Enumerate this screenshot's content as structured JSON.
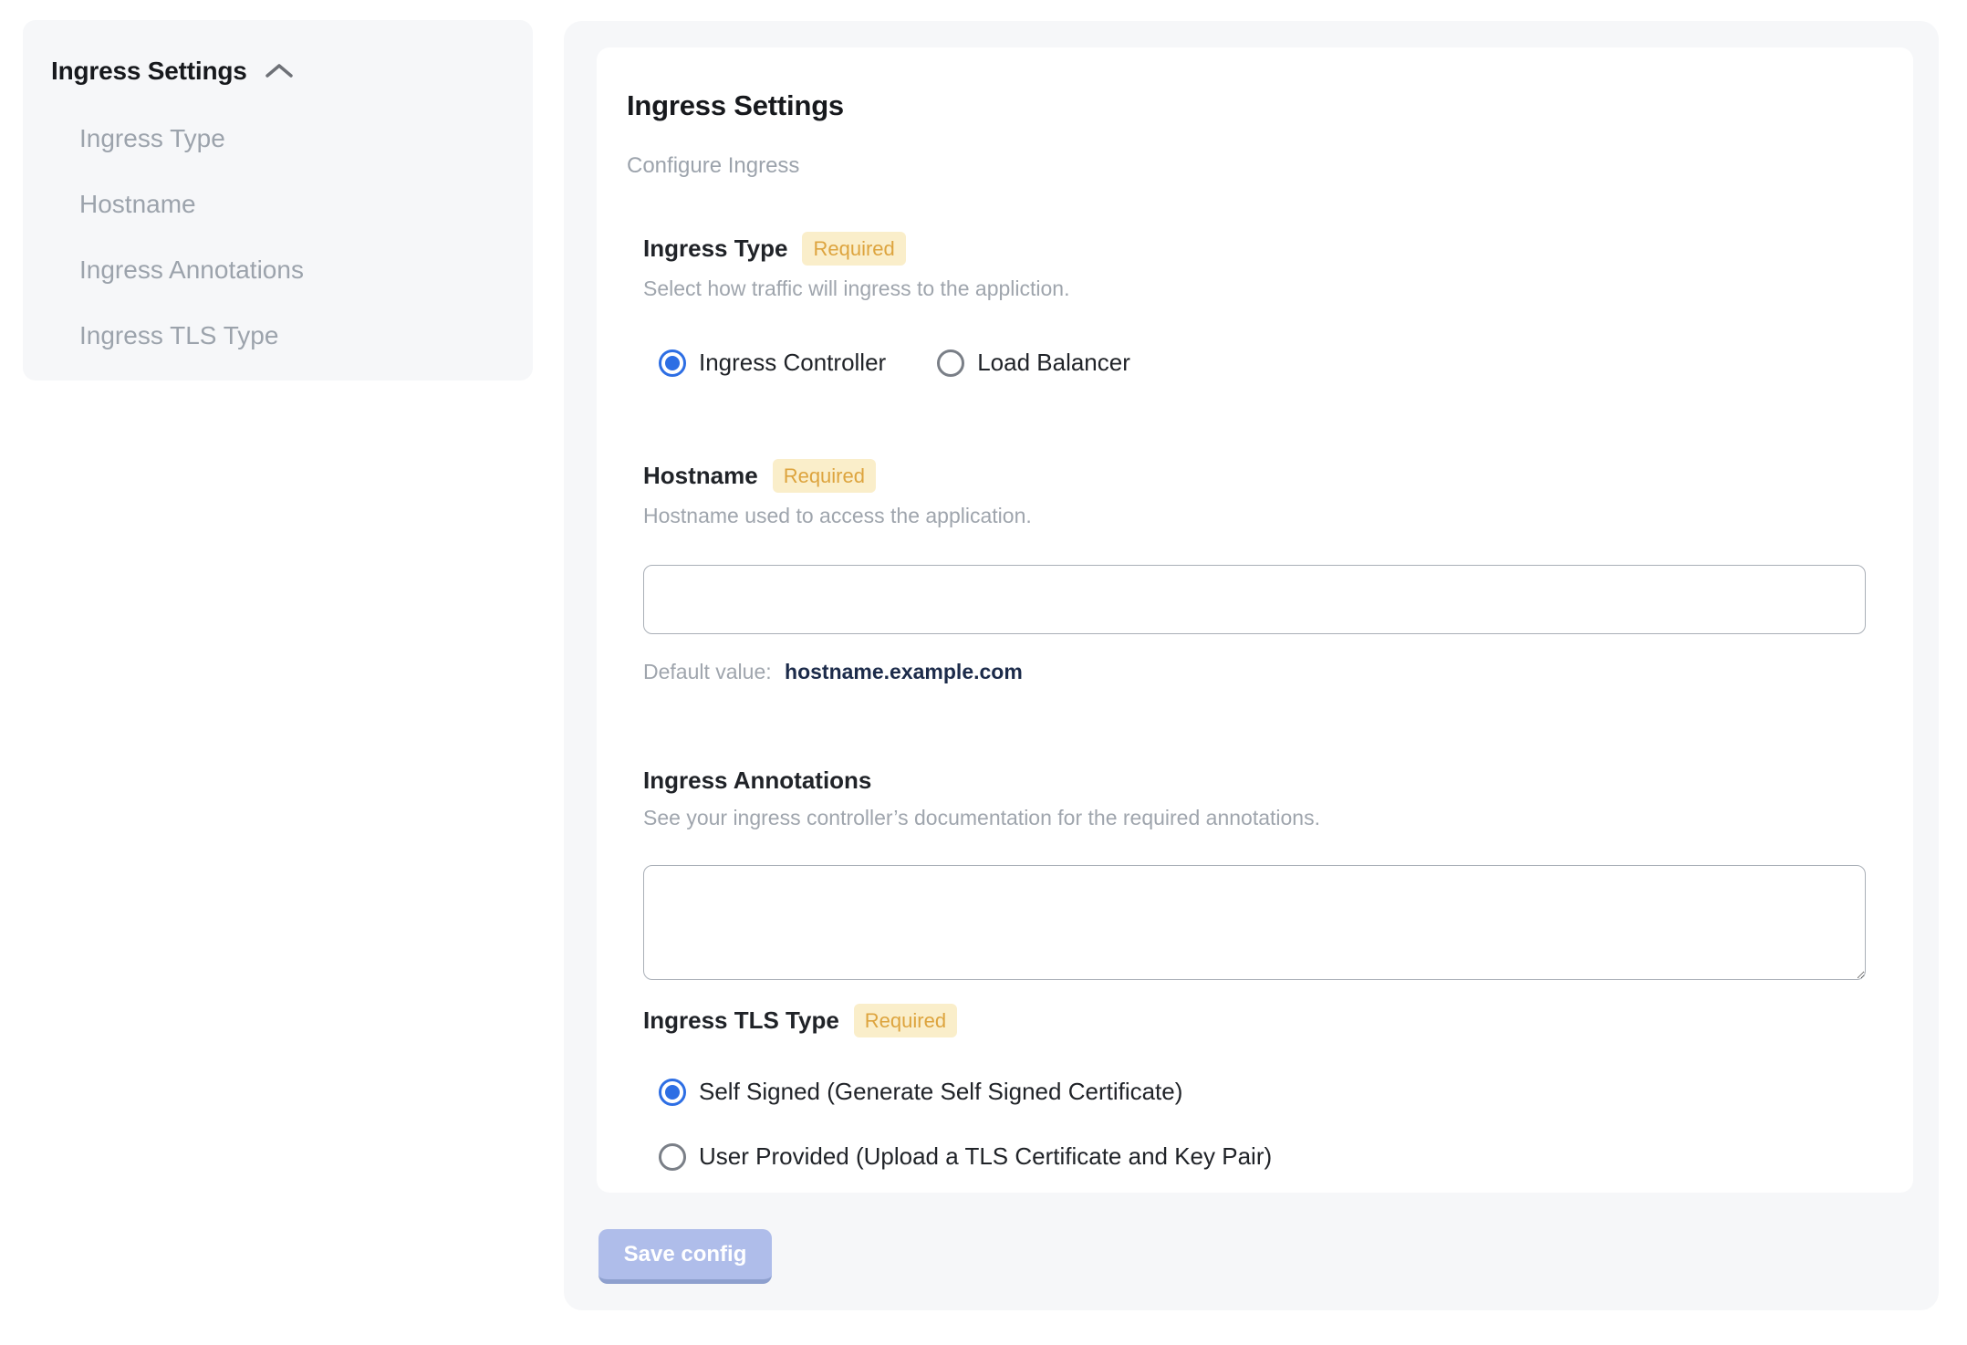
{
  "sidebar": {
    "title": "Ingress Settings",
    "collapse_icon": "chevron-up-icon",
    "items": [
      {
        "label": "Ingress Type"
      },
      {
        "label": "Hostname"
      },
      {
        "label": "Ingress Annotations"
      },
      {
        "label": "Ingress TLS Type"
      }
    ]
  },
  "main": {
    "title": "Ingress Settings",
    "subtitle": "Configure Ingress",
    "required_label": "Required",
    "sections": {
      "ingress_type": {
        "label": "Ingress Type",
        "required": true,
        "description": "Select how traffic will ingress to the appliction.",
        "options": [
          {
            "label": "Ingress Controller",
            "selected": true
          },
          {
            "label": "Load Balancer",
            "selected": false
          }
        ]
      },
      "hostname": {
        "label": "Hostname",
        "required": true,
        "description": "Hostname used to access the application.",
        "value": "",
        "default_prefix": "Default value:",
        "default_value": "hostname.example.com"
      },
      "annotations": {
        "label": "Ingress Annotations",
        "required": false,
        "description": "See your ingress controller’s documentation for the required annotations.",
        "value": ""
      },
      "tls": {
        "label": "Ingress TLS Type",
        "required": true,
        "options": [
          {
            "label": "Self Signed (Generate Self Signed Certificate)",
            "selected": true
          },
          {
            "label": "User Provided (Upload a TLS Certificate and Key Pair)",
            "selected": false
          }
        ]
      }
    },
    "save_button": {
      "label": "Save config",
      "enabled": false
    }
  },
  "colors": {
    "panel_background": "#F6F7F9",
    "card_background": "#FFFFFF",
    "accent_blue": "#2D6EE4",
    "badge_background": "#FAEECA",
    "badge_text": "#DDA43E",
    "muted_text": "#9FA5AD",
    "default_value_text": "#1C2B4A",
    "save_button_background": "#AFBDEA",
    "save_button_text": "#FFFFFF"
  }
}
